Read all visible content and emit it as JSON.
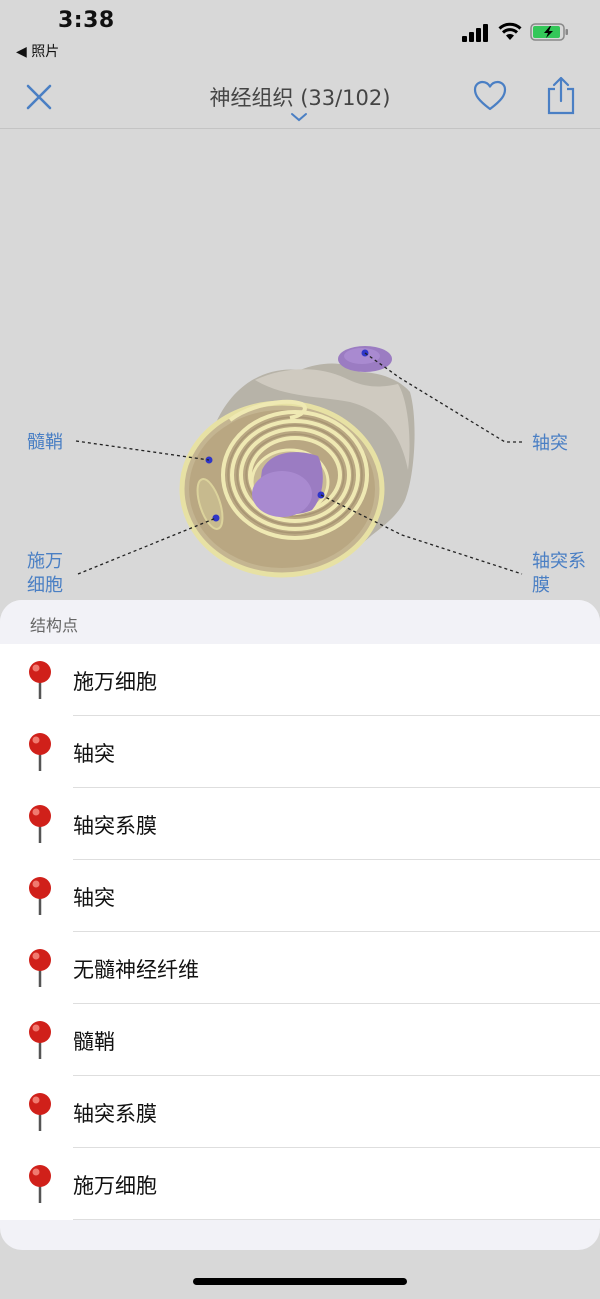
{
  "status": {
    "time": "3:38",
    "back_app": "◀ 照片"
  },
  "nav": {
    "title": "神经组织 (33/102)"
  },
  "figure": {
    "labels": {
      "myelin": "髓鞘",
      "axon": "轴突",
      "schwann": "施万\n细胞",
      "axolemma": "轴突系\n膜"
    }
  },
  "sheet": {
    "title": "结构点",
    "items": [
      "施万细胞",
      "轴突",
      "轴突系膜",
      "轴突",
      "无髓神经纤维",
      "髓鞘",
      "轴突系膜",
      "施万细胞"
    ]
  },
  "colors": {
    "accent": "#4a7fc4",
    "pin": "#d0201a"
  }
}
